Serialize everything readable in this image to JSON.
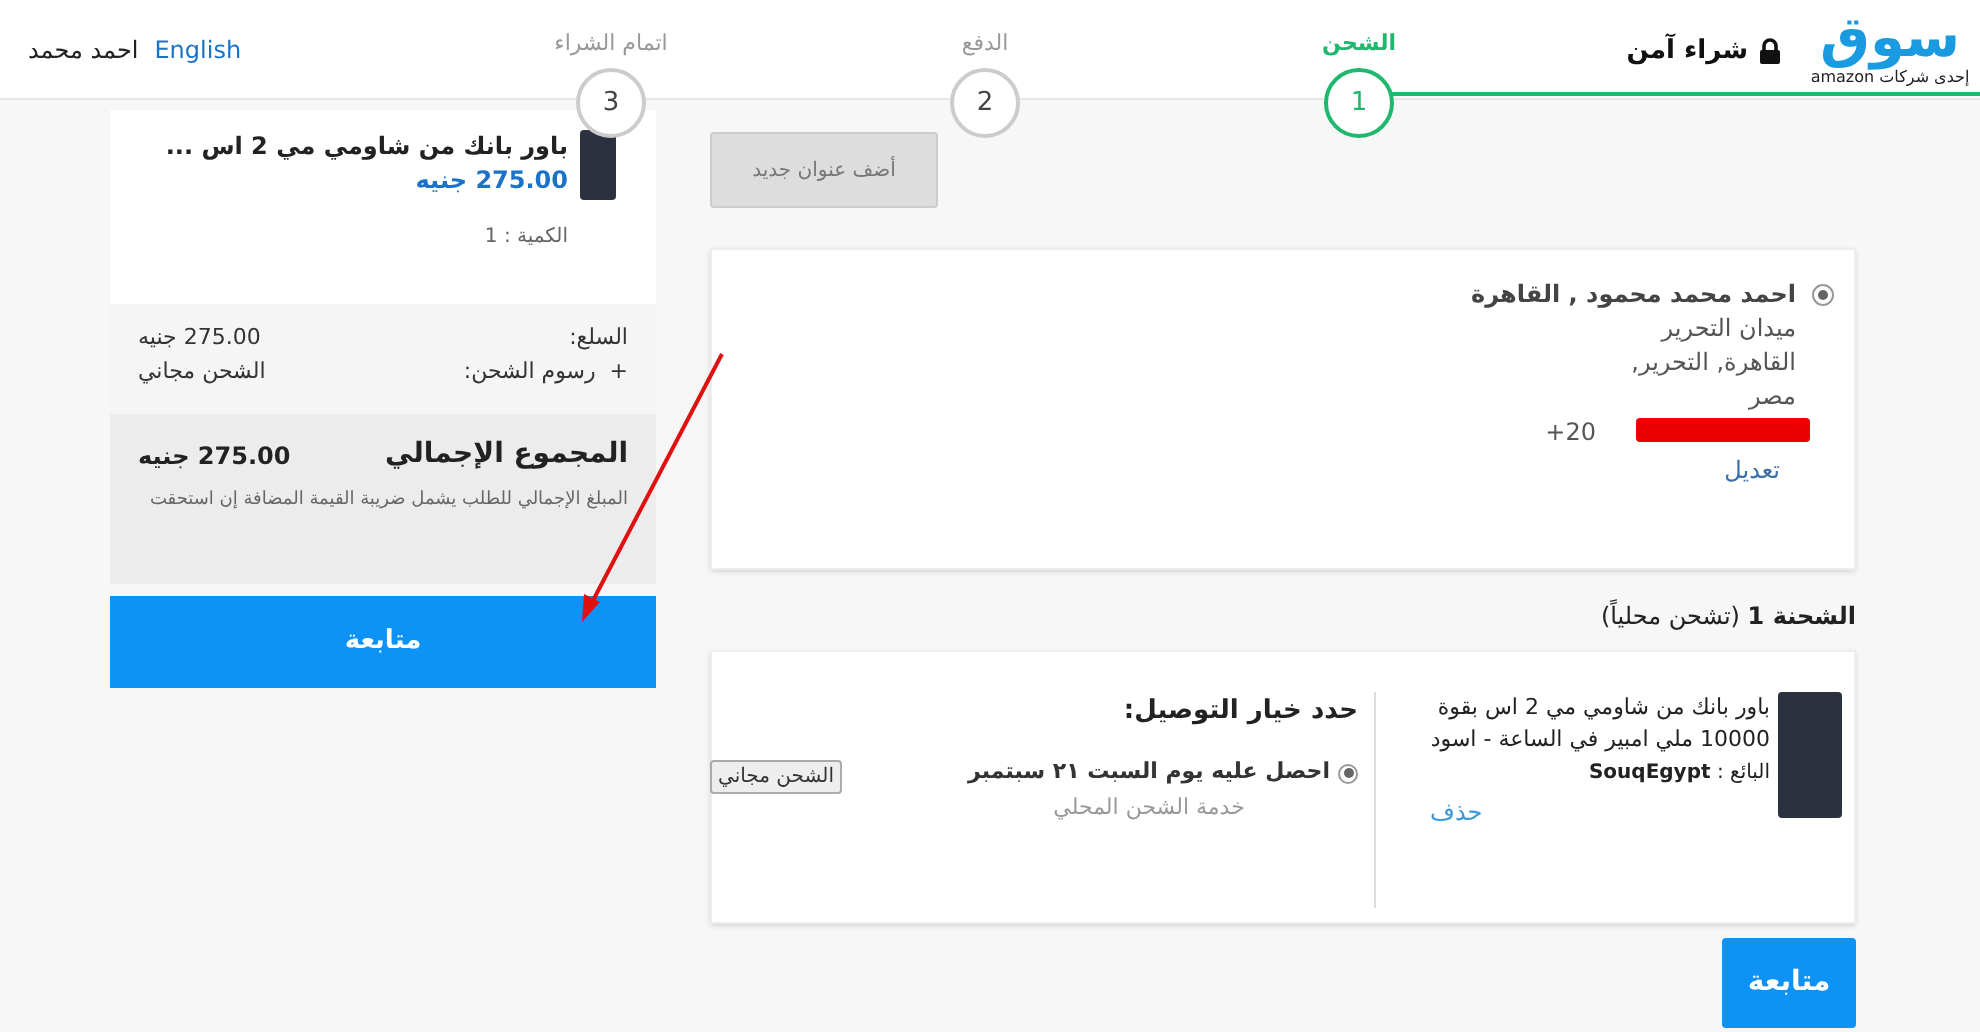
{
  "header": {
    "logo": "سوق",
    "logo_tagline": "إحدى شركات amazon",
    "secure_label": "شراء آمن",
    "language_link": "English",
    "user_name": "احمد محمد"
  },
  "steps": [
    {
      "number": "1",
      "label": "الشحن",
      "selected": true
    },
    {
      "number": "2",
      "label": "الدفع",
      "selected": false
    },
    {
      "number": "3",
      "label": "اتمام الشراء",
      "selected": false
    }
  ],
  "order_summary": {
    "item": {
      "title": "باور بانك من شاومي مي 2 اس ...",
      "price": "275.00 جنيه",
      "quantity": "الكمية : 1"
    },
    "rows": [
      {
        "label": "السلع:",
        "value": "275.00 جنيه"
      },
      {
        "label": "+  رسوم الشحن:",
        "value": "الشحن مجاني"
      }
    ],
    "total_label": "المجموع الإجمالي",
    "total_value": "275.00 جنيه",
    "vat_note": "المبلغ الإجمالي للطلب يشمل ضريبة القيمة المضافة إن استحقت",
    "continue_button": "متابعة"
  },
  "add_address_button": {
    "label": "أضف عنوان جديد",
    "disabled": true
  },
  "address": {
    "selected": true,
    "name": "احمد محمد محمود , القاهرة",
    "lines": [
      "ميدان التحرير",
      "القاهرة, التحرير,",
      "مصر"
    ],
    "phone": "+20",
    "edit_link": "تعديل"
  },
  "shipment": {
    "heading": "**الشحنة 1** (تشحن محلياً)",
    "product_title": "باور بانك من شاومي مي 2 اس بقوة 10000 ملي امبير في الساعة - اسود",
    "seller": "البائع : **SouqEgypt**",
    "delete_link": "حذف",
    "delivery_heading": "حدد خيار التوصيل:",
    "options": [
      {
        "title": "احصل عليه يوم السبت ٢١ سبتمبر",
        "service": "خدمة الشحن المحلي",
        "badge": "الشحن مجاني",
        "selected": true
      }
    ]
  },
  "continue_button": "متابعة"
}
